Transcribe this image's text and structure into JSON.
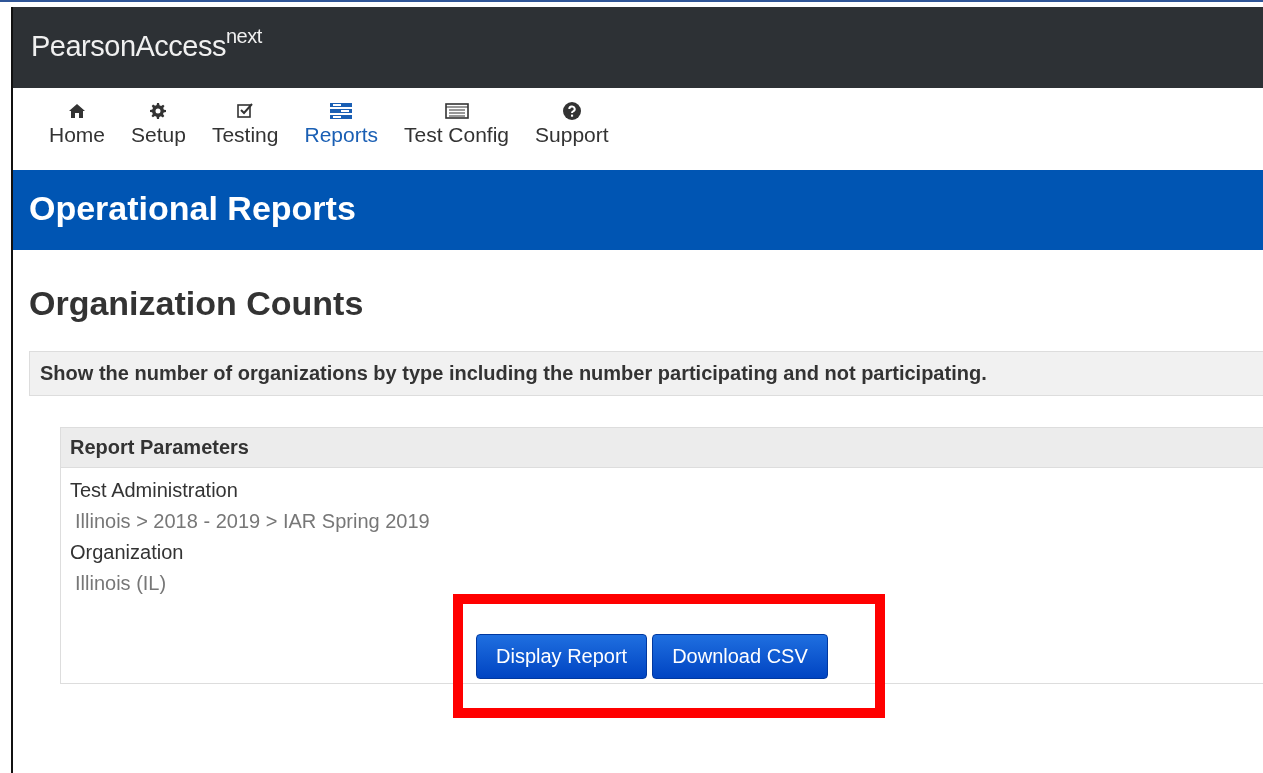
{
  "header": {
    "brand": "PearsonAccess",
    "brand_sup": "next"
  },
  "nav": [
    {
      "label": "Home",
      "kind": "home",
      "selected": false
    },
    {
      "label": "Setup",
      "kind": "gear",
      "selected": false
    },
    {
      "label": "Testing",
      "kind": "check",
      "selected": false
    },
    {
      "label": "Reports",
      "kind": "bars",
      "selected": true
    },
    {
      "label": "Test Config",
      "kind": "list",
      "selected": false
    },
    {
      "label": "Support",
      "kind": "help",
      "selected": false
    }
  ],
  "banner": {
    "title": "Operational Reports"
  },
  "page": {
    "title": "Organization Counts",
    "description": "Show the number of organizations by type including the number participating and not participating."
  },
  "parameters": {
    "heading": "Report Parameters",
    "fields": [
      {
        "label": "Test Administration",
        "value": "Illinois > 2018 - 2019 > IAR Spring 2019"
      },
      {
        "label": "Organization",
        "value": "Illinois (IL)"
      }
    ]
  },
  "buttons": [
    "Display Report",
    "Download CSV"
  ],
  "highlight": {
    "shown": true
  }
}
